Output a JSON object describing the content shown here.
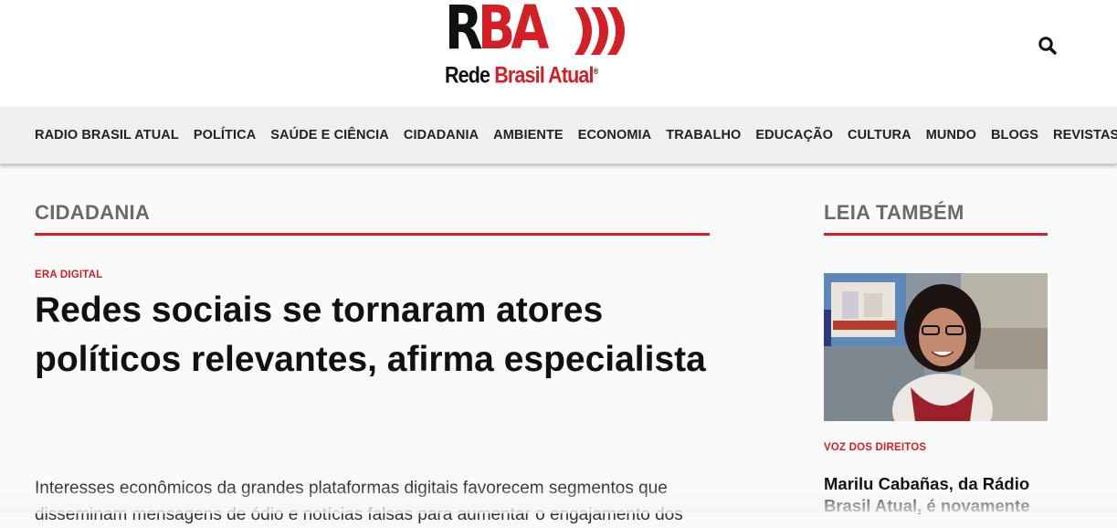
{
  "header": {
    "logo_mark_left": "R",
    "logo_mark_right": "BA",
    "logo_text_black": "Rede",
    "logo_text_red": "Brasil Atual",
    "logo_registered": "®",
    "search_icon": "search-icon",
    "brand_red": "#d32027"
  },
  "nav": {
    "items": [
      "RADIO BRASIL ATUAL",
      "POLÍTICA",
      "SAÚDE E CIÊNCIA",
      "CIDADANIA",
      "AMBIENTE",
      "ECONOMIA",
      "TRABALHO",
      "EDUCAÇÃO",
      "CULTURA",
      "MUNDO",
      "BLOGS",
      "REVISTAS"
    ]
  },
  "main": {
    "section_title": "CIDADANIA",
    "kicker": "ERA DIGITAL",
    "headline": "Redes sociais se tornaram atores políticos relevantes, afirma especialista",
    "lead": "Interesses econômicos da grandes plataformas digitais favorecem segmentos que disseminam mensagens de ódio e notícias falsas para aumentar o engajamento dos"
  },
  "sidebar": {
    "title": "LEIA TAMBÉM",
    "kicker": "VOZ DOS DIREITOS",
    "headline": "Marilu Cabañas, da Rádio Brasil Atual, é novamente"
  }
}
